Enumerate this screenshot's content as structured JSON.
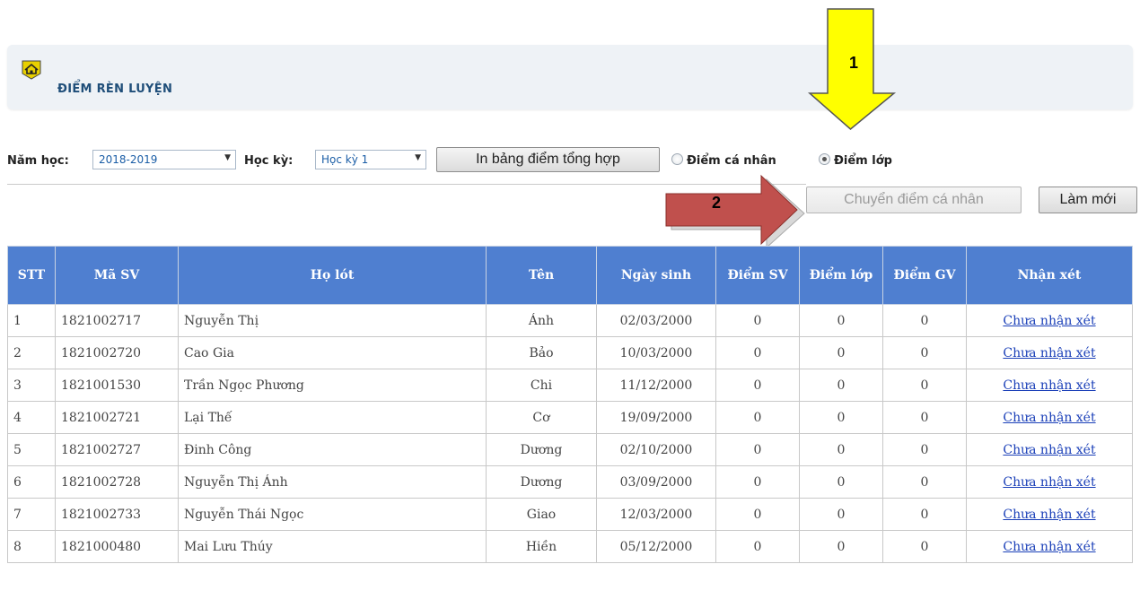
{
  "header": {
    "title": "ĐIỂM RÈN LUYỆN"
  },
  "filters": {
    "year_label": "Năm học:",
    "year_value": "2018-2019",
    "term_label": "Học kỳ:",
    "term_value": "Học kỳ 1",
    "print_button": "In bảng điểm tổng hợp",
    "radio_personal": "Điểm cá nhân",
    "radio_class": "Điểm lớp",
    "selected_radio": "class"
  },
  "actions": {
    "transfer_button": "Chuyển điểm cá nhân",
    "refresh_button": "Làm mới"
  },
  "annotations": {
    "callout_1": "1",
    "callout_2": "2"
  },
  "table": {
    "headers": [
      "STT",
      "Mã SV",
      "Họ lót",
      "Tên",
      "Ngày sinh",
      "Điểm SV",
      "Điểm lớp",
      "Điểm GV",
      "Nhận xét"
    ],
    "rows": [
      {
        "stt": "1",
        "ma_sv": "1821002717",
        "ho_lot": "Nguyễn Thị",
        "ten": "Ánh",
        "ngay_sinh": "02/03/2000",
        "diem_sv": "0",
        "diem_lop": "0",
        "diem_gv": "0",
        "nhan_xet": "Chưa nhận xét"
      },
      {
        "stt": "2",
        "ma_sv": "1821002720",
        "ho_lot": "Cao Gia",
        "ten": "Bảo",
        "ngay_sinh": "10/03/2000",
        "diem_sv": "0",
        "diem_lop": "0",
        "diem_gv": "0",
        "nhan_xet": "Chưa nhận xét"
      },
      {
        "stt": "3",
        "ma_sv": "1821001530",
        "ho_lot": "Trần Ngọc Phương",
        "ten": "Chi",
        "ngay_sinh": "11/12/2000",
        "diem_sv": "0",
        "diem_lop": "0",
        "diem_gv": "0",
        "nhan_xet": "Chưa nhận xét"
      },
      {
        "stt": "4",
        "ma_sv": "1821002721",
        "ho_lot": "Lại Thế",
        "ten": "Cơ",
        "ngay_sinh": "19/09/2000",
        "diem_sv": "0",
        "diem_lop": "0",
        "diem_gv": "0",
        "nhan_xet": "Chưa nhận xét"
      },
      {
        "stt": "5",
        "ma_sv": "1821002727",
        "ho_lot": "Đinh Công",
        "ten": "Dương",
        "ngay_sinh": "02/10/2000",
        "diem_sv": "0",
        "diem_lop": "0",
        "diem_gv": "0",
        "nhan_xet": "Chưa nhận xét"
      },
      {
        "stt": "6",
        "ma_sv": "1821002728",
        "ho_lot": "Nguyễn Thị Ánh",
        "ten": "Dương",
        "ngay_sinh": "03/09/2000",
        "diem_sv": "0",
        "diem_lop": "0",
        "diem_gv": "0",
        "nhan_xet": "Chưa nhận xét"
      },
      {
        "stt": "7",
        "ma_sv": "1821002733",
        "ho_lot": "Nguyễn Thái Ngọc",
        "ten": "Giao",
        "ngay_sinh": "12/03/2000",
        "diem_sv": "0",
        "diem_lop": "0",
        "diem_gv": "0",
        "nhan_xet": "Chưa nhận xét"
      },
      {
        "stt": "8",
        "ma_sv": "1821000480",
        "ho_lot": "Mai Lưu Thúy",
        "ten": "Hiền",
        "ngay_sinh": "05/12/2000",
        "diem_sv": "0",
        "diem_lop": "0",
        "diem_gv": "0",
        "nhan_xet": "Chưa nhận xét"
      }
    ]
  },
  "colors": {
    "header_bg": "#4f7fd0",
    "title": "#1f4e79",
    "callout_yellow": "#ffff00",
    "callout_red": "#c0504d",
    "link": "#1a3fb8"
  }
}
